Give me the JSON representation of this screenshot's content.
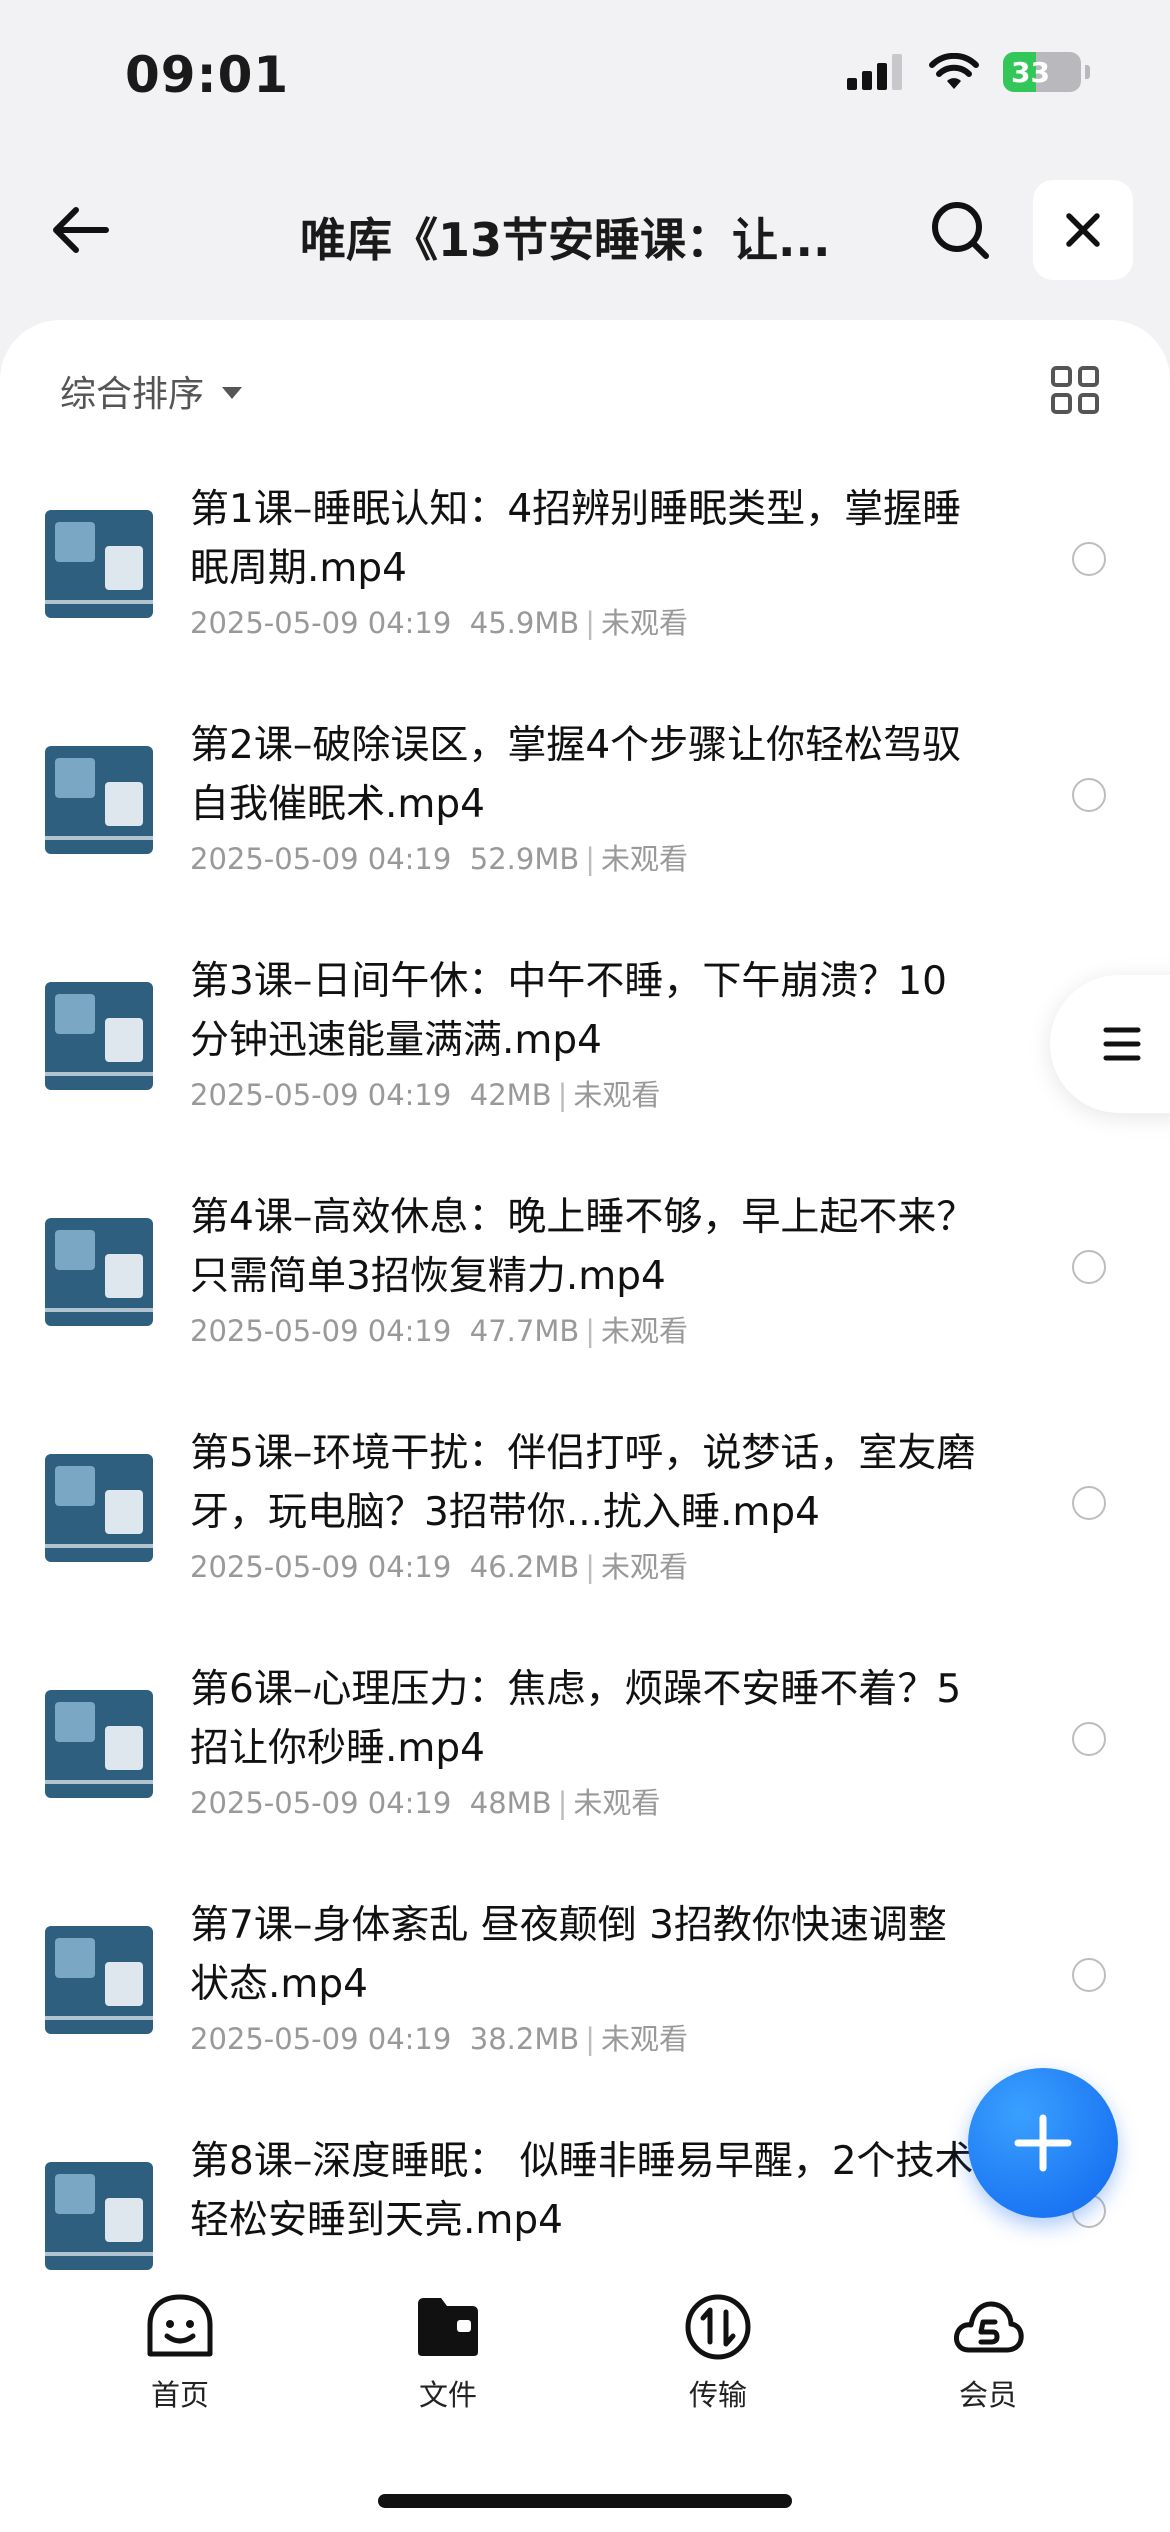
{
  "status_bar": {
    "time": "09:01",
    "battery": "33"
  },
  "header": {
    "title": "唯库《13节安睡课：让..."
  },
  "toolbar": {
    "sort_label": "综合排序"
  },
  "files": [
    {
      "title": "第1课–睡眠认知：4招辨别睡眠类型，掌握睡眠周期.mp4",
      "date": "2025-05-09 04:19",
      "size": "45.9MB",
      "status": "未观看"
    },
    {
      "title": "第2课–破除误区，掌握4个步骤让你轻松驾驭自我催眠术.mp4",
      "date": "2025-05-09 04:19",
      "size": "52.9MB",
      "status": "未观看"
    },
    {
      "title": "第3课–日间午休：中午不睡，下午崩溃？10分钟迅速能量满满.mp4",
      "date": "2025-05-09 04:19",
      "size": "42MB",
      "status": "未观看"
    },
    {
      "title": "第4课–高效休息：晚上睡不够，早上起不来？只需简单3招恢复精力.mp4",
      "date": "2025-05-09 04:19",
      "size": "47.7MB",
      "status": "未观看"
    },
    {
      "title": "第5课–环境干扰：伴侣打呼，说梦话，室友磨牙，玩电脑？3招带你...扰入睡.mp4",
      "date": "2025-05-09 04:19",
      "size": "46.2MB",
      "status": "未观看"
    },
    {
      "title": "第6课–心理压力：焦虑，烦躁不安睡不着？5招让你秒睡.mp4",
      "date": "2025-05-09 04:19",
      "size": "48MB",
      "status": "未观看"
    },
    {
      "title": "第7课–身体紊乱 昼夜颠倒 3招教你快速调整状态.mp4",
      "date": "2025-05-09 04:19",
      "size": "38.2MB",
      "status": "未观看"
    },
    {
      "title": "第8课–深度睡眠： 似睡非睡易早醒，2个技术轻松安睡到天亮.mp4",
      "date": "",
      "size": "",
      "status": ""
    }
  ],
  "tabs": [
    {
      "label": "首页",
      "icon": "smile-icon"
    },
    {
      "label": "文件",
      "icon": "folder-icon"
    },
    {
      "label": "传输",
      "icon": "transfer-icon"
    },
    {
      "label": "会员",
      "icon": "cloud-member-icon"
    }
  ]
}
